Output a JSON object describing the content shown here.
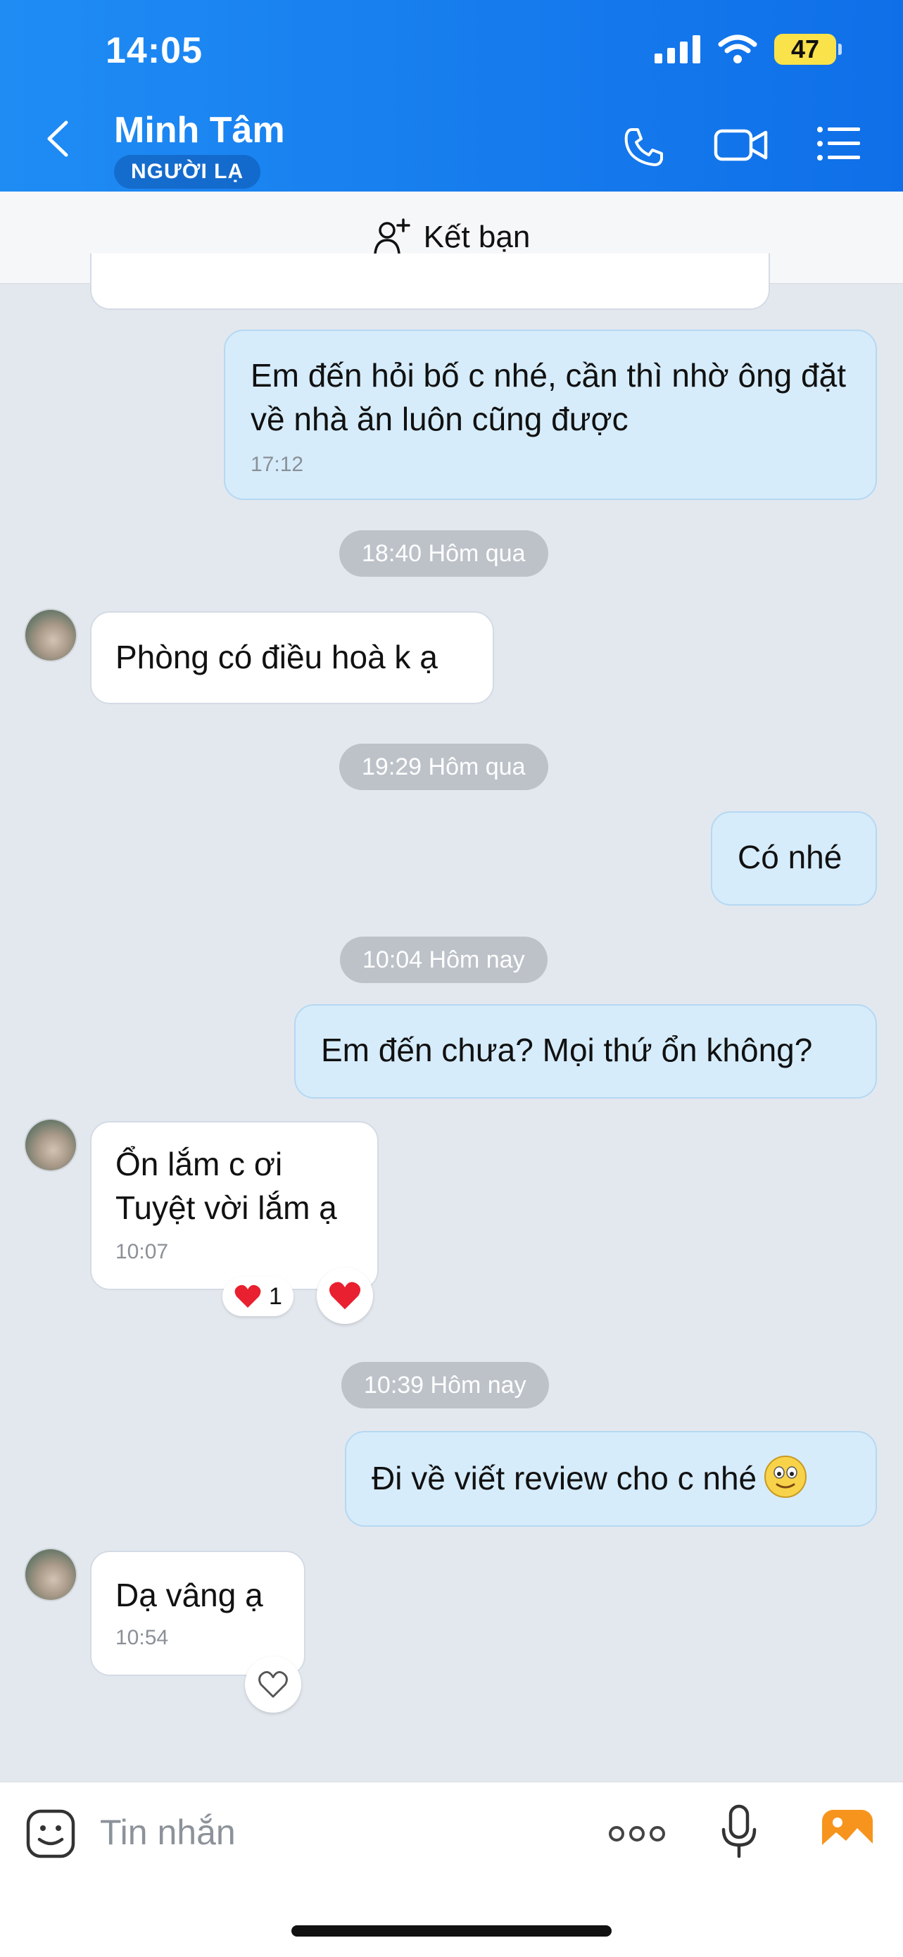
{
  "status_bar": {
    "time": "14:05",
    "battery": "47"
  },
  "header": {
    "contact_name": "Minh Tâm",
    "badge": "NGƯỜI LẠ"
  },
  "add_friend": {
    "label": "Kết bạn"
  },
  "messages": [
    {
      "type": "out",
      "text": "Em đến hỏi bố c nhé, cần thì nhờ ông đặt về nhà ăn luôn cũng được",
      "time": "17:12"
    },
    {
      "type": "divider",
      "text": "18:40 Hôm qua"
    },
    {
      "type": "in",
      "text": "Phòng có điều hoà k ạ"
    },
    {
      "type": "divider",
      "text": "19:29 Hôm qua"
    },
    {
      "type": "out",
      "text": "Có nhé"
    },
    {
      "type": "divider",
      "text": "10:04 Hôm nay"
    },
    {
      "type": "out",
      "text": "Em đến chưa? Mọi thứ ổn không?"
    },
    {
      "type": "in",
      "text_line1": "Ổn lắm c ơi",
      "text_line2": "Tuyệt vời lắm ạ",
      "time": "10:07",
      "reaction_count": "1"
    },
    {
      "type": "divider",
      "text": "10:39 Hôm nay"
    },
    {
      "type": "out",
      "text": "Đi về viết review cho c nhé"
    },
    {
      "type": "in",
      "text": "Dạ vâng ạ",
      "time": "10:54"
    }
  ],
  "composer": {
    "placeholder": "Tin nhắn"
  },
  "colors": {
    "header": "#1280ef",
    "outgoing": "#d6ecfb",
    "incoming": "#ffffff",
    "background": "#e3e8ef",
    "accent_orange": "#f7941d"
  }
}
